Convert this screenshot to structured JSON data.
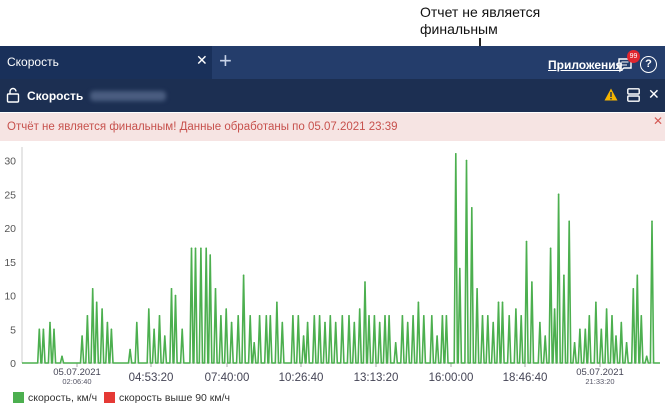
{
  "callout": {
    "line1": "Отчет не является",
    "line2": "финальным"
  },
  "tabs": {
    "active_label": "Скорость",
    "apps_label": "Приложения",
    "badge_count": "99",
    "help_label": "?"
  },
  "toolbar": {
    "title": "Скорость"
  },
  "alert": {
    "text": "Отчёт не является финальным! Данные обработаны по 05.07.2021 23:39"
  },
  "icons": {
    "tab_close": "close-icon",
    "tab_add": "plus-icon",
    "messages": "chat-icon",
    "help": "help-icon",
    "lock": "lock-icon",
    "warning": "warning-icon",
    "layout": "layout-icon",
    "close": "close-icon"
  },
  "colors": {
    "series1": "#4caf4f",
    "series2": "#e53935",
    "tab_bg": "#243d6b",
    "toolbar_bg": "#1c2f52",
    "alert_bg": "#f6e4e3"
  },
  "chart_data": {
    "type": "line",
    "ylim": [
      0,
      32
    ],
    "yticks": [
      "0",
      "5",
      "10",
      "15",
      "20",
      "25",
      "30"
    ],
    "xticks": [
      {
        "label": "05.07.2021",
        "sub": "02:06:40"
      },
      {
        "label": "04:53:20",
        "sub": ""
      },
      {
        "label": "07:40:00",
        "sub": ""
      },
      {
        "label": "10:26:40",
        "sub": ""
      },
      {
        "label": "13:13:20",
        "sub": ""
      },
      {
        "label": "16:00:00",
        "sub": ""
      },
      {
        "label": "18:46:40",
        "sub": ""
      },
      {
        "label": "05.07.2021",
        "sub": "21:33:20"
      }
    ],
    "legend": [
      {
        "name": "скорость, км/ч",
        "color": "#4caf4f"
      },
      {
        "name": "скорость выше 90 км/ч",
        "color": "#e53935"
      }
    ],
    "series": [
      {
        "name": "скорость, км/ч",
        "peaks": [
          [
            0.5,
            5
          ],
          [
            0.65,
            5
          ],
          [
            0.9,
            6
          ],
          [
            1.05,
            5
          ],
          [
            1.35,
            1
          ],
          [
            2.1,
            4
          ],
          [
            2.3,
            7
          ],
          [
            2.5,
            11
          ],
          [
            2.65,
            9
          ],
          [
            2.85,
            8
          ],
          [
            3.05,
            6
          ],
          [
            3.2,
            5
          ],
          [
            3.9,
            2
          ],
          [
            4.15,
            6
          ],
          [
            4.6,
            8
          ],
          [
            4.8,
            5
          ],
          [
            5.0,
            7
          ],
          [
            5.2,
            4
          ],
          [
            5.45,
            11
          ],
          [
            5.6,
            10
          ],
          [
            5.85,
            5
          ],
          [
            6.2,
            17
          ],
          [
            6.35,
            17
          ],
          [
            6.55,
            17
          ],
          [
            6.75,
            17
          ],
          [
            6.9,
            16
          ],
          [
            7.1,
            11
          ],
          [
            7.3,
            7
          ],
          [
            7.5,
            8
          ],
          [
            7.7,
            6
          ],
          [
            7.95,
            7
          ],
          [
            8.15,
            13
          ],
          [
            8.4,
            7
          ],
          [
            8.55,
            3
          ],
          [
            8.75,
            7
          ],
          [
            9.0,
            7
          ],
          [
            9.15,
            7
          ],
          [
            9.4,
            9
          ],
          [
            9.6,
            6
          ],
          [
            10.0,
            7
          ],
          [
            10.2,
            7
          ],
          [
            10.4,
            4
          ],
          [
            10.55,
            6
          ],
          [
            10.8,
            7
          ],
          [
            11.0,
            7
          ],
          [
            11.2,
            6
          ],
          [
            11.4,
            7
          ],
          [
            11.6,
            6
          ],
          [
            11.85,
            7
          ],
          [
            12.1,
            7
          ],
          [
            12.3,
            6
          ],
          [
            12.5,
            8
          ],
          [
            12.7,
            12
          ],
          [
            12.85,
            7
          ],
          [
            13.05,
            7
          ],
          [
            13.25,
            6
          ],
          [
            13.45,
            7
          ],
          [
            13.6,
            7
          ],
          [
            13.85,
            3
          ],
          [
            14.1,
            7
          ],
          [
            14.3,
            6
          ],
          [
            14.5,
            7
          ],
          [
            14.7,
            9
          ],
          [
            14.9,
            7
          ],
          [
            15.2,
            7
          ],
          [
            15.4,
            4
          ],
          [
            15.6,
            7
          ],
          [
            15.75,
            7
          ],
          [
            16.1,
            31
          ],
          [
            16.25,
            14
          ],
          [
            16.5,
            30
          ],
          [
            16.7,
            23
          ],
          [
            16.9,
            11
          ],
          [
            17.1,
            7
          ],
          [
            17.3,
            7
          ],
          [
            17.5,
            6
          ],
          [
            17.7,
            9
          ],
          [
            17.85,
            9
          ],
          [
            18.1,
            7
          ],
          [
            18.35,
            8
          ],
          [
            18.55,
            7
          ],
          [
            18.75,
            18
          ],
          [
            18.95,
            12
          ],
          [
            19.25,
            6
          ],
          [
            19.45,
            4
          ],
          [
            19.65,
            17
          ],
          [
            19.8,
            8
          ],
          [
            19.95,
            25
          ],
          [
            20.15,
            13
          ],
          [
            20.35,
            21
          ],
          [
            20.55,
            3
          ],
          [
            20.75,
            5
          ],
          [
            20.95,
            5
          ],
          [
            21.1,
            7
          ],
          [
            21.35,
            9
          ],
          [
            21.55,
            5
          ],
          [
            21.75,
            8
          ],
          [
            21.95,
            7
          ],
          [
            22.1,
            4
          ],
          [
            22.3,
            6
          ],
          [
            22.5,
            3
          ],
          [
            22.75,
            11
          ],
          [
            22.9,
            13
          ],
          [
            23.05,
            7
          ],
          [
            23.25,
            1
          ],
          [
            23.45,
            21
          ]
        ],
        "range": [
          0,
          23.6
        ]
      },
      {
        "name": "скорость выше 90 км/ч",
        "peaks": []
      }
    ]
  }
}
